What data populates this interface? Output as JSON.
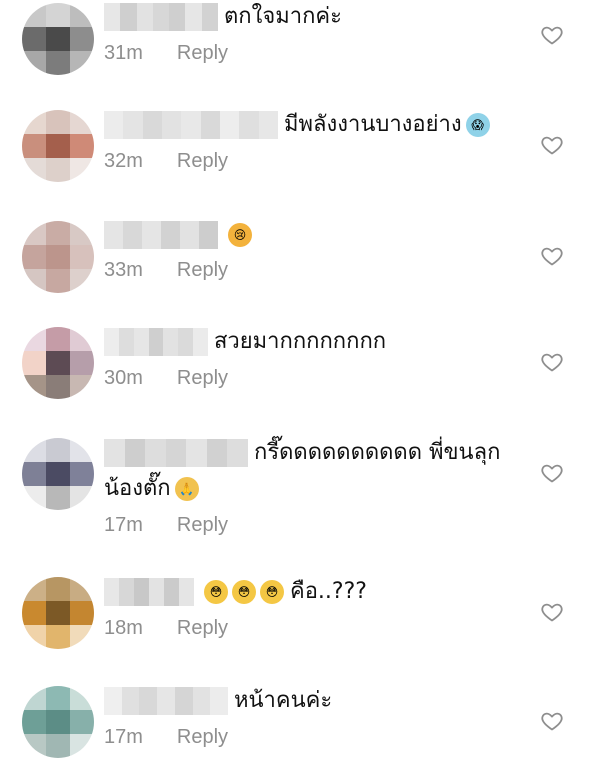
{
  "comments": [
    {
      "text": "ตกใจมากค่ะ",
      "time": "31m",
      "reply_label": "Reply",
      "avatar_colors": [
        "#c8c8c8",
        "#d4d4d4",
        "#bdbdbd",
        "#6b6b6b",
        "#4a4a4a",
        "#8d8d8d",
        "#a8a8a8",
        "#7c7c7c",
        "#b6b6b6"
      ],
      "username_colors": [
        "#e7e7e7",
        "#cfcfcf",
        "#e2e2e2",
        "#d7d7d7",
        "#cfcfcf",
        "#e6e6e6",
        "#d2d2d2"
      ],
      "emoji": []
    },
    {
      "text": "มีพลังงานบางอย่าง",
      "time": "32m",
      "reply_label": "Reply",
      "avatar_colors": [
        "#e6d7cf",
        "#d8c3bb",
        "#e5d7d2",
        "#c98f7d",
        "#a45f4c",
        "#cf8a77",
        "#e4dbd7",
        "#ddd0ca",
        "#efe7e4"
      ],
      "username_colors": [
        "#ececec",
        "#e4e4e4",
        "#d9d9d9",
        "#e2e2e2",
        "#e8e8e8",
        "#d9d9d9",
        "#ededed",
        "#dfdfdf",
        "#e7e7e7"
      ],
      "emoji": [
        {
          "glyph": "😱",
          "bg": "#8fd2e8"
        }
      ]
    },
    {
      "text": "",
      "time": "33m",
      "reply_label": "Reply",
      "avatar_colors": [
        "#d9c8c4",
        "#c9aca5",
        "#d8c9c5",
        "#c5a49d",
        "#bc958c",
        "#d7c1bc",
        "#d5c6c2",
        "#c7a8a1",
        "#ddd0cc"
      ],
      "username_colors": [
        "#e5e5e5",
        "#d8d8d8",
        "#e5e5e5",
        "#d2d2d2",
        "#e2e2e2",
        "#cdcdcd"
      ],
      "emoji": [
        {
          "glyph": "😢",
          "bg": "#f3b23c"
        }
      ]
    },
    {
      "text": "สวยมากกกกกกกก",
      "time": "30m",
      "reply_label": "Reply",
      "avatar_colors": [
        "#ead8e1",
        "#c59ca7",
        "#e0cbd4",
        "#f2d3c8",
        "#5d4b54",
        "#b69eaa",
        "#a59488",
        "#8a7d78",
        "#c8b8b2"
      ],
      "username_colors": [
        "#ededed",
        "#dddddd",
        "#e6e6e6",
        "#cfcfcf",
        "#e2e2e2",
        "#dadada",
        "#ebebeb"
      ],
      "emoji": []
    },
    {
      "text": "กรี๊ดดดดดดดดดด พี่ขนลุก",
      "text2": "น้องตั๊ก",
      "time": "17m",
      "reply_label": "Reply",
      "avatar_colors": [
        "#dcdde4",
        "#c9cad2",
        "#e2e3e9",
        "#7e8096",
        "#4b4b63",
        "#7f8199",
        "#ececec",
        "#b8b8b8",
        "#e4e4e4"
      ],
      "username_colors": [
        "#e3e3e3",
        "#cecece",
        "#dddddd",
        "#d5d5d5",
        "#e4e4e4",
        "#d1d1d1",
        "#dddddd"
      ],
      "emoji": [],
      "emoji2": [
        {
          "glyph": "🙏",
          "bg": "#f1c24f"
        }
      ]
    },
    {
      "text": "คือ..???",
      "time": "18m",
      "reply_label": "Reply",
      "avatar_colors": [
        "#ccb087",
        "#b79663",
        "#c8ac83",
        "#c9892f",
        "#7c5926",
        "#c48630",
        "#f0d3a9",
        "#e1b56c",
        "#f1dbba"
      ],
      "username_colors": [
        "#e7e7e7",
        "#d7d7d7",
        "#c8c8c8",
        "#e3e3e3",
        "#cbcbcb",
        "#e5e5e5"
      ],
      "emoji": [
        {
          "glyph": "😳",
          "bg": "#f4c744"
        },
        {
          "glyph": "😳",
          "bg": "#f4c744"
        },
        {
          "glyph": "😳",
          "bg": "#f4c744"
        }
      ]
    },
    {
      "text": "หน้าคนค่ะ",
      "time": "17m",
      "reply_label": "Reply",
      "avatar_colors": [
        "#bfd6d2",
        "#8db9b3",
        "#c9ddd8",
        "#6e9f97",
        "#5c8d86",
        "#87b0aa",
        "#b8c8c4",
        "#a0b7b3",
        "#d9e4e2"
      ],
      "username_colors": [
        "#efefef",
        "#e0e0e0",
        "#d8d8d8",
        "#e6e6e6",
        "#d5d5d5",
        "#e2e2e2",
        "#ececec"
      ],
      "emoji": []
    }
  ]
}
